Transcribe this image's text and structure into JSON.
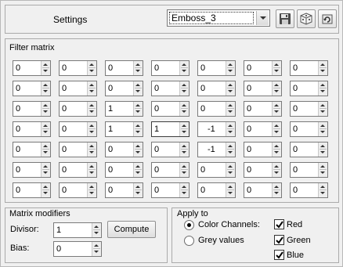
{
  "header": {
    "settings_label": "Settings",
    "preset_value": "Emboss_3",
    "save_icon": "floppy-disk-icon",
    "randomize_icon": "dice-icon",
    "reset_icon": "reset-icon"
  },
  "filter_matrix": {
    "title": "Filter matrix",
    "rows": [
      [
        "0",
        "0",
        "0",
        "0",
        "0",
        "0",
        "0"
      ],
      [
        "0",
        "0",
        "0",
        "0",
        "0",
        "0",
        "0"
      ],
      [
        "0",
        "0",
        "1",
        "0",
        "0",
        "0",
        "0"
      ],
      [
        "0",
        "0",
        "1",
        "1",
        "-1",
        "0",
        "0"
      ],
      [
        "0",
        "0",
        "0",
        "0",
        "-1",
        "0",
        "0"
      ],
      [
        "0",
        "0",
        "0",
        "0",
        "0",
        "0",
        "0"
      ],
      [
        "0",
        "0",
        "0",
        "0",
        "0",
        "0",
        "0"
      ]
    ]
  },
  "modifiers": {
    "title": "Matrix modifiers",
    "divisor_label": "Divisor:",
    "divisor_value": "1",
    "compute_label": "Compute",
    "bias_label": "Bias:",
    "bias_value": "0"
  },
  "apply_to": {
    "title": "Apply to",
    "color_channels_label": "Color Channels:",
    "grey_values_label": "Grey values",
    "mode": "color",
    "red_label": "Red",
    "green_label": "Green",
    "blue_label": "Blue",
    "red_checked": true,
    "green_checked": true,
    "blue_checked": true
  }
}
